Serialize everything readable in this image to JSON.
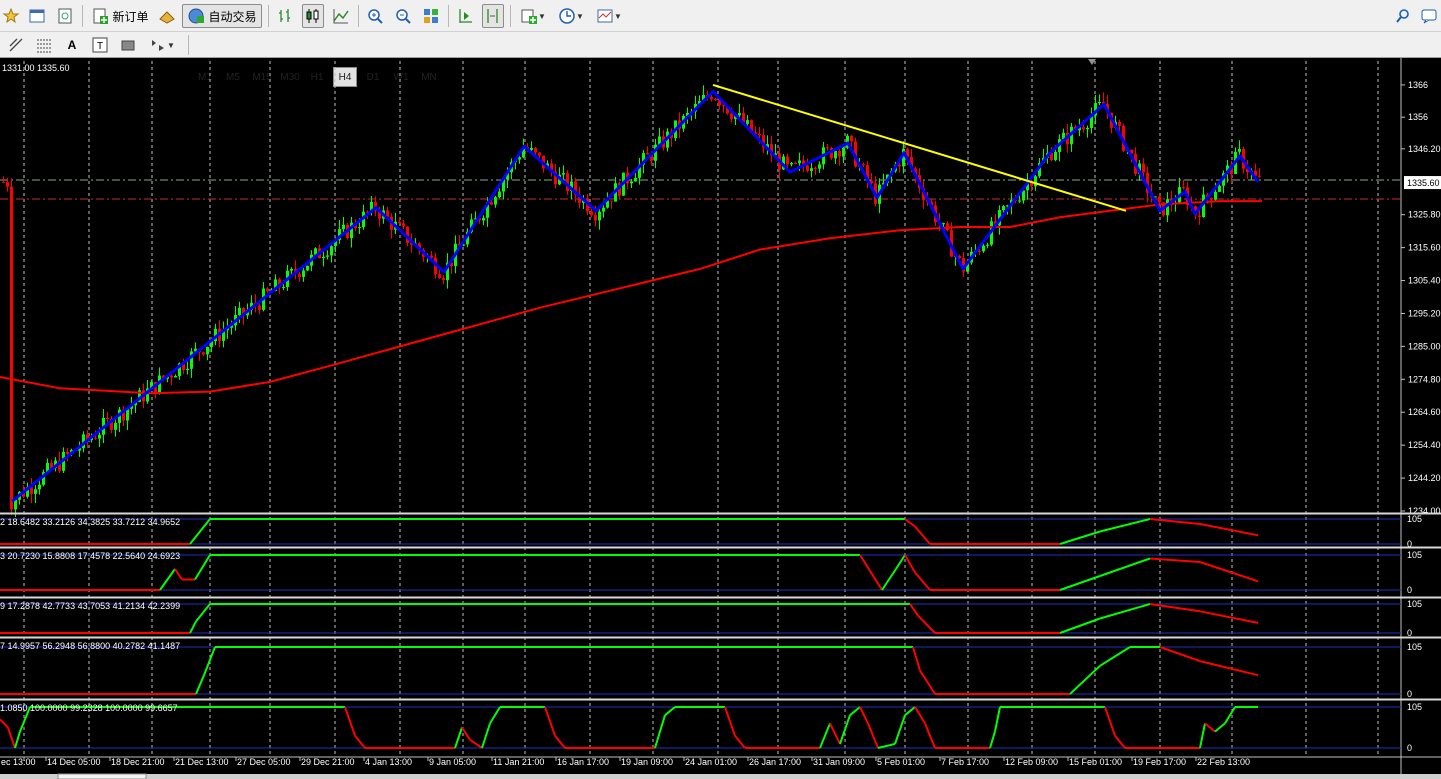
{
  "toolbar": {
    "new_order_label": "新订单",
    "auto_trading_label": "自动交易"
  },
  "timeframes": [
    "M1",
    "M5",
    "M15",
    "M30",
    "H1",
    "H4",
    "D1",
    "W1",
    "MN"
  ],
  "active_timeframe": "H4",
  "chart": {
    "info_text": "1331.00 1335.60",
    "current_price_label": "1335.60",
    "price_ticks": [
      "1366",
      "1356",
      "1346.20",
      "1335.60",
      "1325.80",
      "1315.60",
      "1305.40",
      "1295.20",
      "1285.00",
      "1274.80",
      "1264.60",
      "1254.40",
      "1244.20",
      "1234.00"
    ],
    "time_labels": [
      "ec 13:00",
      "14 Dec 05:00",
      "18 Dec 21:00",
      "21 Dec 13:00",
      "27 Dec 05:00",
      "29 Dec 21:00",
      "4 Jan 13:00",
      "9 Jan 05:00",
      "11 Jan 21:00",
      "16 Jan 17:00",
      "19 Jan 09:00",
      "24 Jan 01:00",
      "26 Jan 17:00",
      "31 Jan 09:00",
      "5 Feb 01:00",
      "7 Feb 17:00",
      "12 Feb 09:00",
      "15 Feb 01:00",
      "19 Feb 17:00",
      "22 Feb 13:00"
    ],
    "zigzag_pivots": [
      1237,
      1328,
      1308,
      1347,
      1327,
      1364,
      1339,
      1348,
      1331,
      1345,
      1309,
      1345,
      1360,
      1327,
      1333,
      1326,
      1344,
      1336
    ],
    "trendline": {
      "from_price": 1366,
      "to_price": 1327
    },
    "colors": {
      "bull": "#00ff00",
      "bear": "#ff0000",
      "zigzag": "#0000ff",
      "trendline": "#ffff00",
      "ma": "#ff0000",
      "grid": "#c0c0c0"
    }
  },
  "indicators": [
    {
      "readout": "2 18.6482 33.2126 34.3825 33.7212 34.9652",
      "level_top": "105",
      "level_bottom": "0"
    },
    {
      "readout": "3 20.7230 15.8808 17.4578 22.5640 24.6923",
      "level_top": "105",
      "level_bottom": "0"
    },
    {
      "readout": "9 17.2878 42.7733 43.7053 41.2134 42.2399",
      "level_top": "105",
      "level_bottom": "0"
    },
    {
      "readout": "7 14.9957 56.2948 56.8800 40.2782 41.1487",
      "level_top": "105",
      "level_bottom": "0"
    },
    {
      "readout": "1.0850 100.0000 99.2328 100.0000 99.6657",
      "level_top": "105",
      "level_bottom": "0"
    }
  ]
}
